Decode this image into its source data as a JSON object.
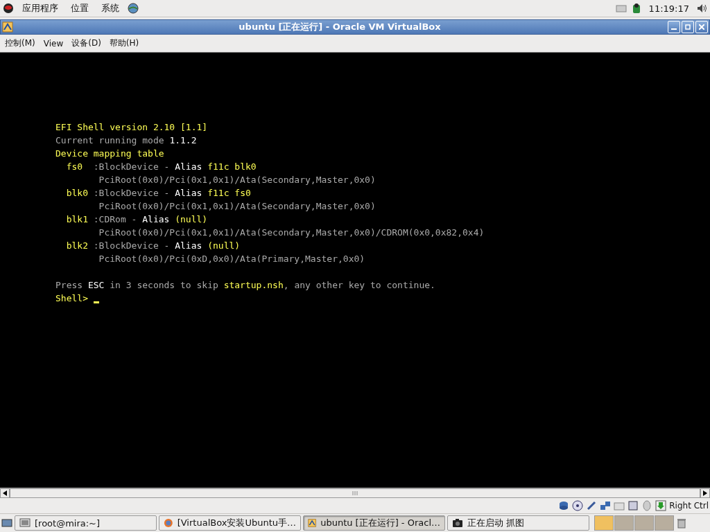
{
  "top_panel": {
    "menus": [
      "应用程序",
      "位置",
      "系统"
    ],
    "clock": "11:19:17"
  },
  "window": {
    "title": "ubuntu [正在运行] - Oracle VM VirtualBox"
  },
  "menu_bar": [
    "控制(M)",
    "View",
    "设备(D)",
    "帮助(H)"
  ],
  "console": {
    "blocks": [
      [
        [
          {
            "text": "EFI Shell version 2.10 [1.1]",
            "kind": "yellow"
          }
        ],
        [
          {
            "text": "Current running mode ",
            "kind": "gray"
          },
          {
            "text": "1.1.2",
            "kind": "white"
          }
        ],
        [
          {
            "text": "Device mapping table",
            "kind": "yellow"
          }
        ],
        [
          {
            "text": "  fs0  ",
            "kind": "yellow"
          },
          {
            "text": ":BlockDevice - ",
            "kind": "gray"
          },
          {
            "text": "Alias ",
            "kind": "white"
          },
          {
            "text": "f11c blk0",
            "kind": "yellow"
          }
        ],
        [
          {
            "text": "        PciRoot(0x0)/Pci(0x1,0x1)/Ata(Secondary,Master,0x0)",
            "kind": "gray"
          }
        ],
        [
          {
            "text": "  blk0 ",
            "kind": "yellow"
          },
          {
            "text": ":BlockDevice - ",
            "kind": "gray"
          },
          {
            "text": "Alias ",
            "kind": "white"
          },
          {
            "text": "f11c fs0",
            "kind": "yellow"
          }
        ],
        [
          {
            "text": "        PciRoot(0x0)/Pci(0x1,0x1)/Ata(Secondary,Master,0x0)",
            "kind": "gray"
          }
        ],
        [
          {
            "text": "  blk1 ",
            "kind": "yellow"
          },
          {
            "text": ":CDRom - ",
            "kind": "gray"
          },
          {
            "text": "Alias ",
            "kind": "white"
          },
          {
            "text": "(null)",
            "kind": "yellow"
          }
        ],
        [
          {
            "text": "        PciRoot(0x0)/Pci(0x1,0x1)/Ata(Secondary,Master,0x0)/CDROM(0x0,0x82,0x4)",
            "kind": "gray"
          }
        ],
        [
          {
            "text": "  blk2 ",
            "kind": "yellow"
          },
          {
            "text": ":BlockDevice - ",
            "kind": "gray"
          },
          {
            "text": "Alias ",
            "kind": "white"
          },
          {
            "text": "(null)",
            "kind": "yellow"
          }
        ],
        [
          {
            "text": "        PciRoot(0x0)/Pci(0xD,0x0)/Ata(Primary,Master,0x0)",
            "kind": "gray"
          }
        ]
      ],
      [
        [
          {
            "text": "Press ",
            "kind": "gray"
          },
          {
            "text": "ESC",
            "kind": "white"
          },
          {
            "text": " in 3 seconds to skip ",
            "kind": "gray"
          },
          {
            "text": "startup.nsh",
            "kind": "yellow"
          },
          {
            "text": ", any other key to continue.",
            "kind": "gray"
          }
        ],
        [
          {
            "text": "Shell> ",
            "kind": "yellow"
          }
        ]
      ]
    ],
    "cursor": true
  },
  "status_bar": {
    "host_key": "Right Ctrl"
  },
  "taskbar": [
    {
      "label": "[root@mira:~]",
      "kind": "terminal",
      "selected": false
    },
    {
      "label": "[VirtualBox安装Ubuntu手…",
      "kind": "browser",
      "selected": false
    },
    {
      "label": "ubuntu [正在运行] - Oracl…",
      "kind": "vbox",
      "selected": true
    },
    {
      "label": "正在启动 抓图",
      "kind": "camera",
      "selected": false
    }
  ]
}
